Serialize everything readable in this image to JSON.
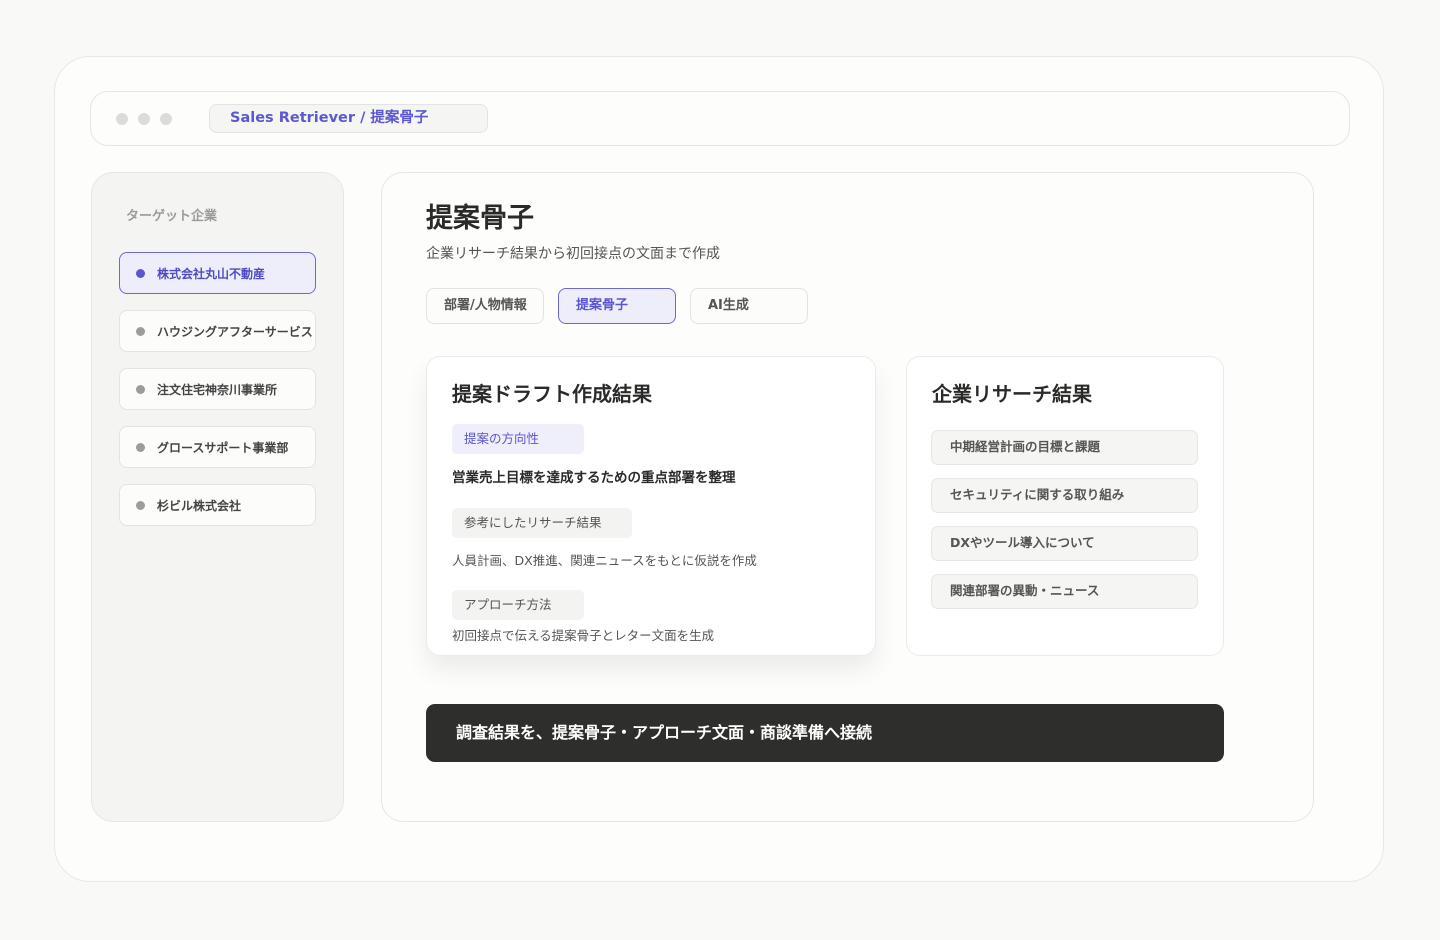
{
  "window": {
    "title": "Sales Retriever / 提案骨子"
  },
  "sidebar": {
    "title": "ターゲット企業",
    "items": [
      {
        "label": "株式会社丸山不動産",
        "active": true
      },
      {
        "label": "ハウジングアフターサービス",
        "active": false
      },
      {
        "label": "注文住宅神奈川事業所",
        "active": false
      },
      {
        "label": "グロースサポート事業部",
        "active": false
      },
      {
        "label": "杉ビル株式会社",
        "active": false
      }
    ]
  },
  "main": {
    "title": "提案骨子",
    "subtitle": "企業リサーチ結果から初回接点の文面まで作成",
    "tabs": [
      {
        "label": "部署/人物情報",
        "active": false
      },
      {
        "label": "提案骨子",
        "active": true
      },
      {
        "label": "AI生成",
        "active": false
      }
    ]
  },
  "draft": {
    "title": "提案ドラフト作成結果",
    "direction_chip": "提案の方向性",
    "direction_text": "営業売上目標を達成するための重点部署を整理",
    "reference_chip": "参考にしたリサーチ結果",
    "reference_text": "人員計画、DX推進、関連ニュースをもとに仮説を作成",
    "approach_chip": "アプローチ方法",
    "approach_text": "初回接点で伝える提案骨子とレター文面を生成"
  },
  "research": {
    "title": "企業リサーチ結果",
    "items": [
      "中期経営計画の目標と課題",
      "セキュリティに関する取り組み",
      "DXやツール導入について",
      "関連部署の異動・ニュース"
    ]
  },
  "cta": {
    "label": "調査結果を、提案骨子・アプローチ文面・商談準備へ接続"
  },
  "colors": {
    "accent": "#5a55d0",
    "accent_bg": "#eeeefb",
    "cta_bg": "#2e2e2c",
    "background": "#f9f9f7"
  }
}
